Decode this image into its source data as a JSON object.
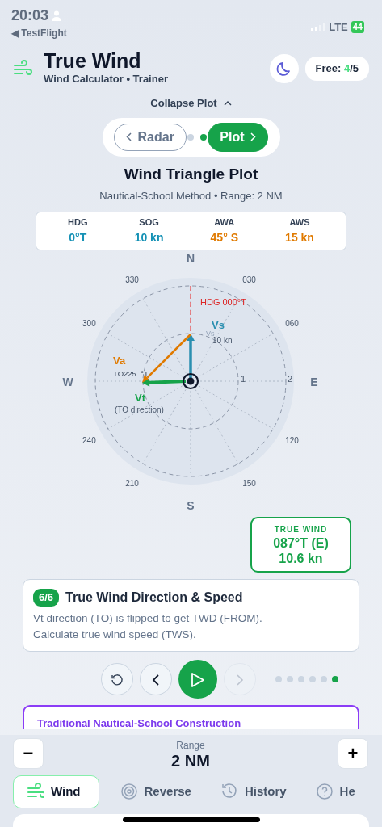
{
  "status_bar": {
    "time": "20:03",
    "back": "◀ TestFlight",
    "network": "LTE",
    "battery": "44"
  },
  "header": {
    "title": "True Wind",
    "subtitle": "Wind Calculator • Trainer",
    "free": {
      "label": "Free: ",
      "used": "4",
      "total": "/5"
    }
  },
  "collapse": "Collapse Plot",
  "pages": [
    {
      "label": "Radar",
      "selected": false
    },
    {
      "label": "Plot",
      "selected": true
    }
  ],
  "plot_title": "Wind Triangle Plot",
  "plot_subtitle": "Nautical-School Method • Range: 2 NM",
  "stats": [
    {
      "label": "HDG",
      "value": "0°T",
      "color": "#1591b5"
    },
    {
      "label": "SOG",
      "value": "10 kn",
      "color": "#1591b5"
    },
    {
      "label": "AWA",
      "value": "45° S",
      "color": "#e07a00"
    },
    {
      "label": "AWS",
      "value": "15 kn",
      "color": "#e07a00"
    }
  ],
  "plot": {
    "compass": [
      "N",
      "E",
      "S",
      "W"
    ],
    "bearings": [
      "030",
      "060",
      "120",
      "150",
      "210",
      "240",
      "300",
      "330"
    ],
    "rings": [
      "1",
      "2"
    ],
    "heading": "HDG 000°T",
    "vectors": [
      {
        "name": "Vs",
        "color": "#2a8fb0",
        "notes": [
          "Vs",
          "10 kn"
        ]
      },
      {
        "name": "Va",
        "color": "#e07a00",
        "notes": [
          "TO225  °T"
        ]
      },
      {
        "name": "Vt",
        "color": "#16a34a",
        "notes": [
          "(TO direction)"
        ]
      }
    ]
  },
  "true_wind": {
    "label": "TRUE WIND",
    "direction": "087°T (E)",
    "speed": "10.6 kn"
  },
  "step": {
    "badge": "6/6",
    "title": "True Wind Direction & Speed",
    "text": "Vt direction (TO) is flipped to get TWD (FROM). Calculate true wind speed (TWS)."
  },
  "controls": {
    "next_disabled": true,
    "steps": [
      {
        "selected": false
      },
      {
        "selected": false
      },
      {
        "selected": false
      },
      {
        "selected": false
      },
      {
        "selected": false
      },
      {
        "selected": true
      }
    ]
  },
  "construction_title": "Traditional Nautical-School Construction",
  "range": {
    "label": "Range",
    "value": "2 NM",
    "minus": "−",
    "plus": "+"
  },
  "tabs": [
    {
      "label": "Wind",
      "kind": "wind",
      "selected": true
    },
    {
      "label": "Reverse",
      "kind": "target",
      "selected": false
    },
    {
      "label": "History",
      "kind": "history",
      "selected": false
    },
    {
      "label": "He",
      "kind": "help",
      "selected": false
    }
  ]
}
